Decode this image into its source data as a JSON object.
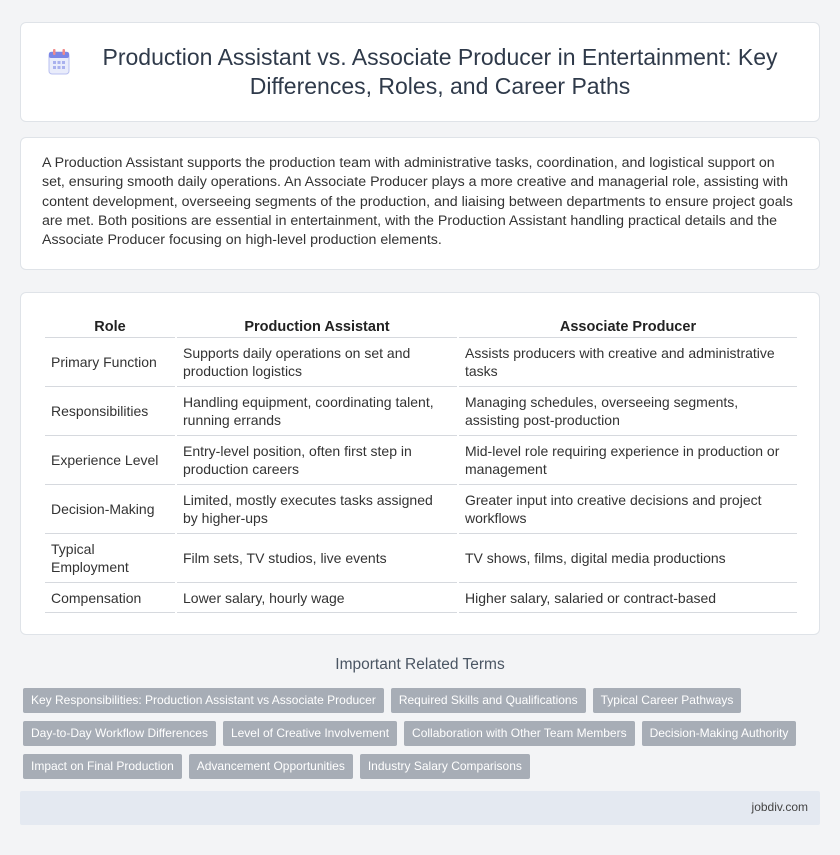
{
  "header": {
    "title": "Production Assistant vs. Associate Producer in Entertainment: Key Differences, Roles, and Career Paths",
    "icon": "document-icon",
    "accent": "#6c7ae0"
  },
  "intro": {
    "text": "A Production Assistant supports the production team with administrative tasks, coordination, and logistical support on set, ensuring smooth daily operations. An Associate Producer plays a more creative and managerial role, assisting with content development, overseeing segments of the production, and liaising between departments to ensure project goals are met. Both positions are essential in entertainment, with the Production Assistant handling practical details and the Associate Producer focusing on high-level production elements."
  },
  "table": {
    "headers": [
      "Role",
      "Production Assistant",
      "Associate Producer"
    ],
    "rows": [
      [
        "Primary Function",
        "Supports daily operations on set and production logistics",
        "Assists producers with creative and administrative tasks"
      ],
      [
        "Responsibilities",
        "Handling equipment, coordinating talent, running errands",
        "Managing schedules, overseeing segments, assisting post-production"
      ],
      [
        "Experience Level",
        "Entry-level position, often first step in production careers",
        "Mid-level role requiring experience in production or management"
      ],
      [
        "Decision-Making",
        "Limited, mostly executes tasks assigned by higher-ups",
        "Greater input into creative decisions and project workflows"
      ],
      [
        "Typical Employment",
        "Film sets, TV studios, live events",
        "TV shows, films, digital media productions"
      ],
      [
        "Compensation",
        "Lower salary, hourly wage",
        "Higher salary, salaried or contract-based"
      ]
    ]
  },
  "related": {
    "title": "Important Related Terms",
    "tags": [
      "Key Responsibilities: Production Assistant vs Associate Producer",
      "Required Skills and Qualifications",
      "Typical Career Pathways",
      "Day-to-Day Workflow Differences",
      "Level of Creative Involvement",
      "Collaboration with Other Team Members",
      "Decision-Making Authority",
      "Impact on Final Production",
      "Advancement Opportunities",
      "Industry Salary Comparisons"
    ]
  },
  "footer": {
    "site": "jobdiv.com"
  }
}
